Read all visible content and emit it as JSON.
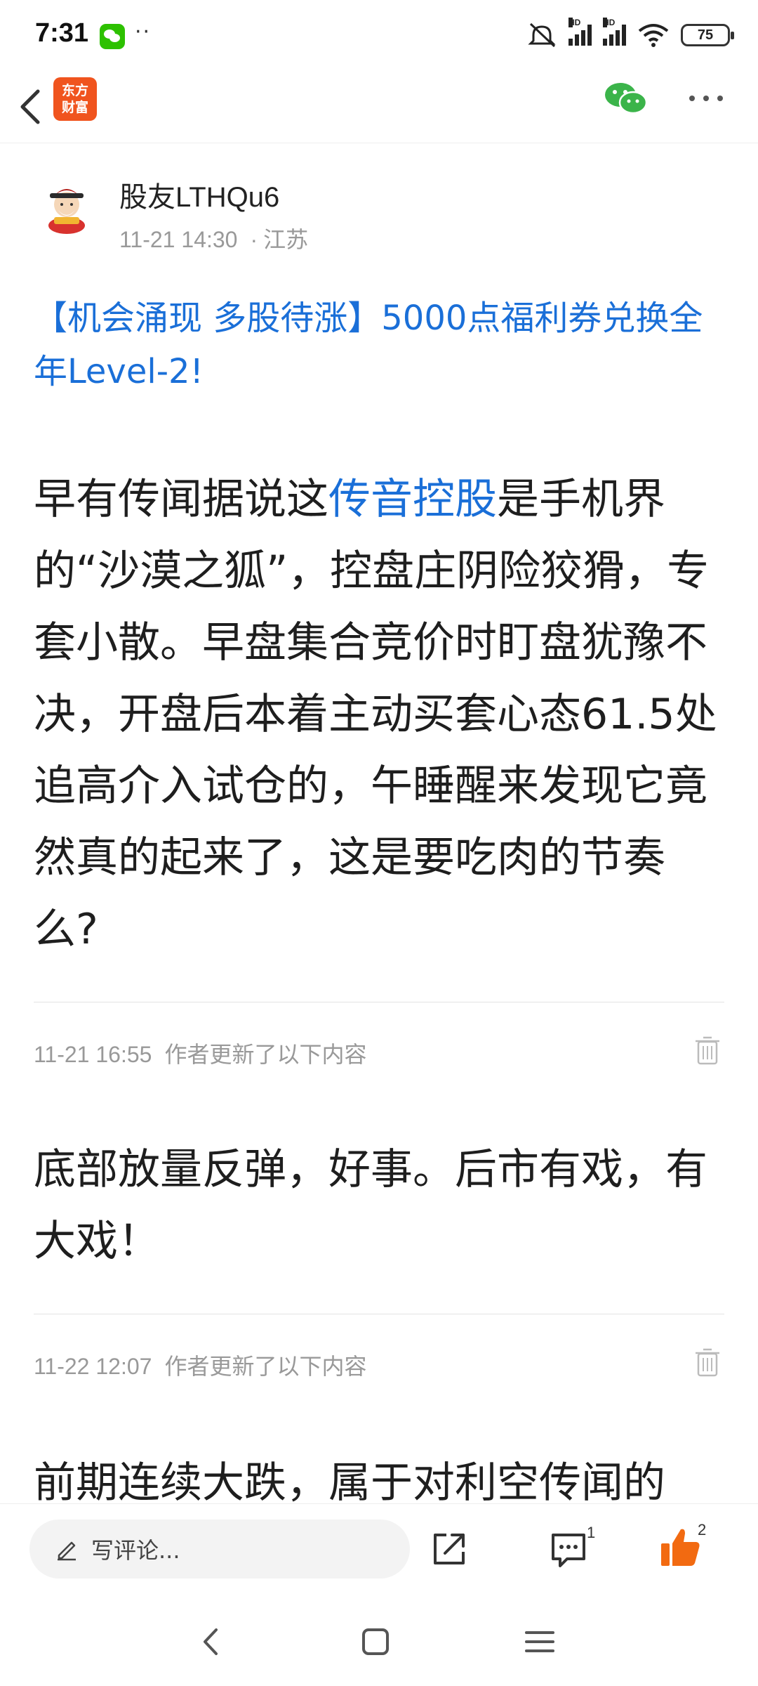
{
  "status_bar": {
    "time": "7:31",
    "dots": "··",
    "battery": "75",
    "hd": "HD"
  },
  "app": {
    "logo_text": "东方\n财富"
  },
  "author": {
    "name": "股友LTHQu6",
    "time": "11-21 14:30",
    "location": "江苏"
  },
  "post": {
    "title": "【机会涌现 多股待涨】5000点福利券兑换全年Level-2!",
    "body_prefix": "早有传闻据说这",
    "body_link": "传音控股",
    "body_suffix": "是手机界的“沙漠之狐”，控盘庄阴险狡猾，专套小散。早盘集合竞价时盯盘犹豫不决，开盘后本着主动买套心态61.5处追高介入试仓的，午睡醒来发现它竟然真的起来了，这是要吃肉的节奏么?"
  },
  "updates": [
    {
      "time": "11-21 16:55",
      "label": "作者更新了以下内容",
      "text": "底部放量反弹，好事。后市有戏，有大戏！"
    },
    {
      "time": "11-22 12:07",
      "label": "作者更新了以下内容",
      "text": "前期连续大跌，属于对利空传闻的"
    }
  ],
  "action_bar": {
    "comment_placeholder": "写评论...",
    "comment_count": "1",
    "like_count": "2",
    "like_color": "#f26a11"
  },
  "icons": {
    "back": "chevron-left-icon",
    "share_wechat": "wechat-icon",
    "more": "more-dots-icon",
    "trash": "trash-icon",
    "share": "share-icon",
    "comment": "comment-icon",
    "like": "thumbs-up-icon"
  }
}
